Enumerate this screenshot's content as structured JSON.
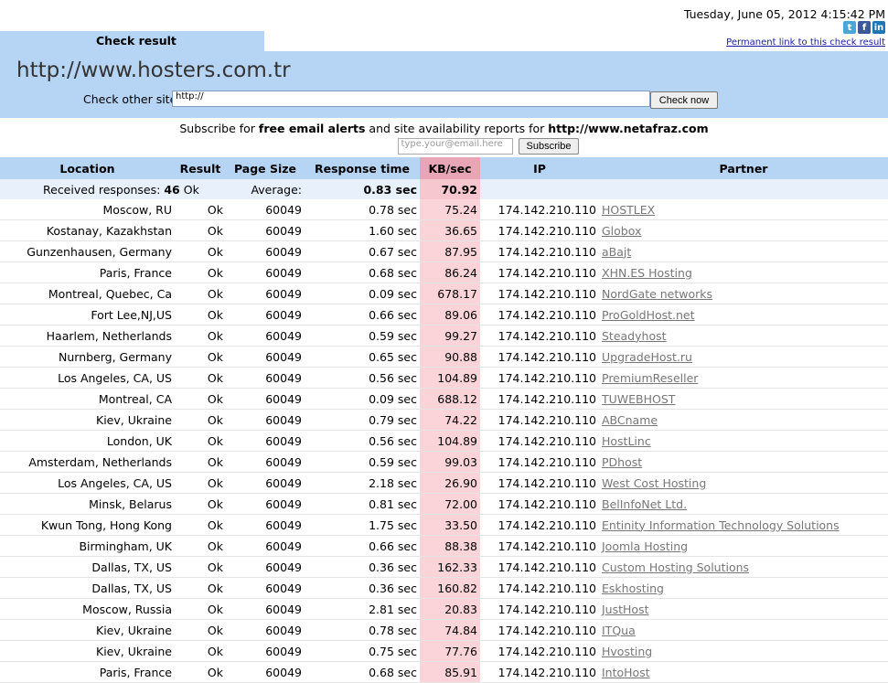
{
  "header": {
    "datetime": "Tuesday, June 05, 2012 4:15:42 PM",
    "social": [
      "t",
      "f",
      "in"
    ],
    "permalink": "Permanent link to this check result",
    "tab_label": "Check result",
    "site_url": "http://www.hosters.com.tr",
    "check_label": "Check other site:",
    "check_input_value": "http://",
    "check_button": "Check now"
  },
  "subscribe": {
    "text_prefix": "Subscribe for ",
    "text_bold": "free email alerts",
    "text_mid": " and site availability reports for ",
    "text_site": "http://www.netafraz.com",
    "email_placeholder": "type.your@email.here",
    "button": "Subscribe"
  },
  "table": {
    "columns": [
      "Location",
      "Result",
      "Page Size",
      "Response time",
      "KB/sec",
      "IP",
      "Partner"
    ],
    "summary": {
      "received_label": "Received responses:",
      "received_count": "46",
      "received_status": "Ok",
      "average_label": "Average:",
      "avg_response": "0.83 sec",
      "avg_kb": "70.92"
    },
    "rows": [
      {
        "location": "Moscow, RU",
        "result": "Ok",
        "size": "60049",
        "time": "0.78 sec",
        "kb": "75.24",
        "ip": "174.142.210.110",
        "partner": "HOSTLEX"
      },
      {
        "location": "Kostanay, Kazakhstan",
        "result": "Ok",
        "size": "60049",
        "time": "1.60 sec",
        "kb": "36.65",
        "ip": "174.142.210.110",
        "partner": "Globox"
      },
      {
        "location": "Gunzenhausen, Germany",
        "result": "Ok",
        "size": "60049",
        "time": "0.67 sec",
        "kb": "87.95",
        "ip": "174.142.210.110",
        "partner": "aBajt"
      },
      {
        "location": "Paris, France",
        "result": "Ok",
        "size": "60049",
        "time": "0.68 sec",
        "kb": "86.24",
        "ip": "174.142.210.110",
        "partner": "XHN.ES Hosting"
      },
      {
        "location": "Montreal, Quebec, Ca",
        "result": "Ok",
        "size": "60049",
        "time": "0.09 sec",
        "kb": "678.17",
        "ip": "174.142.210.110",
        "partner": "NordGate networks"
      },
      {
        "location": "Fort Lee,NJ,US",
        "result": "Ok",
        "size": "60049",
        "time": "0.66 sec",
        "kb": "89.06",
        "ip": "174.142.210.110",
        "partner": "ProGoldHost.net"
      },
      {
        "location": "Haarlem, Netherlands",
        "result": "Ok",
        "size": "60049",
        "time": "0.59 sec",
        "kb": "99.27",
        "ip": "174.142.210.110",
        "partner": "Steadyhost"
      },
      {
        "location": "Nurnberg, Germany",
        "result": "Ok",
        "size": "60049",
        "time": "0.65 sec",
        "kb": "90.88",
        "ip": "174.142.210.110",
        "partner": "UpgradeHost.ru"
      },
      {
        "location": "Los Angeles, CA, US",
        "result": "Ok",
        "size": "60049",
        "time": "0.56 sec",
        "kb": "104.89",
        "ip": "174.142.210.110",
        "partner": "PremiumReseller"
      },
      {
        "location": "Montreal, CA",
        "result": "Ok",
        "size": "60049",
        "time": "0.09 sec",
        "kb": "688.12",
        "ip": "174.142.210.110",
        "partner": "TUWEBHOST"
      },
      {
        "location": "Kiev, Ukraine",
        "result": "Ok",
        "size": "60049",
        "time": "0.79 sec",
        "kb": "74.22",
        "ip": "174.142.210.110",
        "partner": "ABCname"
      },
      {
        "location": "London, UK",
        "result": "Ok",
        "size": "60049",
        "time": "0.56 sec",
        "kb": "104.89",
        "ip": "174.142.210.110",
        "partner": "HostLinc"
      },
      {
        "location": "Amsterdam, Netherlands",
        "result": "Ok",
        "size": "60049",
        "time": "0.59 sec",
        "kb": "99.03",
        "ip": "174.142.210.110",
        "partner": "PDhost"
      },
      {
        "location": "Los Angeles, CA, US",
        "result": "Ok",
        "size": "60049",
        "time": "2.18 sec",
        "kb": "26.90",
        "ip": "174.142.210.110",
        "partner": "West Cost Hosting"
      },
      {
        "location": "Minsk, Belarus",
        "result": "Ok",
        "size": "60049",
        "time": "0.81 sec",
        "kb": "72.00",
        "ip": "174.142.210.110",
        "partner": "BelInfoNet Ltd."
      },
      {
        "location": "Kwun Tong, Hong Kong",
        "result": "Ok",
        "size": "60049",
        "time": "1.75 sec",
        "kb": "33.50",
        "ip": "174.142.210.110",
        "partner": "Entinity Information Technology Solutions"
      },
      {
        "location": "Birmingham, UK",
        "result": "Ok",
        "size": "60049",
        "time": "0.66 sec",
        "kb": "88.38",
        "ip": "174.142.210.110",
        "partner": "Joomla Hosting"
      },
      {
        "location": "Dallas, TX, US",
        "result": "Ok",
        "size": "60049",
        "time": "0.36 sec",
        "kb": "162.33",
        "ip": "174.142.210.110",
        "partner": "Custom Hosting Solutions"
      },
      {
        "location": "Dallas, TX, US",
        "result": "Ok",
        "size": "60049",
        "time": "0.36 sec",
        "kb": "160.82",
        "ip": "174.142.210.110",
        "partner": "Eskhosting"
      },
      {
        "location": "Moscow, Russia",
        "result": "Ok",
        "size": "60049",
        "time": "2.81 sec",
        "kb": "20.83",
        "ip": "174.142.210.110",
        "partner": "JustHost"
      },
      {
        "location": "Kiev, Ukraine",
        "result": "Ok",
        "size": "60049",
        "time": "0.78 sec",
        "kb": "74.84",
        "ip": "174.142.210.110",
        "partner": "ITQua"
      },
      {
        "location": "Kiev, Ukraine",
        "result": "Ok",
        "size": "60049",
        "time": "0.75 sec",
        "kb": "77.76",
        "ip": "174.142.210.110",
        "partner": "Hvosting"
      },
      {
        "location": "Paris, France",
        "result": "Ok",
        "size": "60049",
        "time": "0.68 sec",
        "kb": "85.91",
        "ip": "174.142.210.110",
        "partner": "IntoHost"
      }
    ]
  }
}
